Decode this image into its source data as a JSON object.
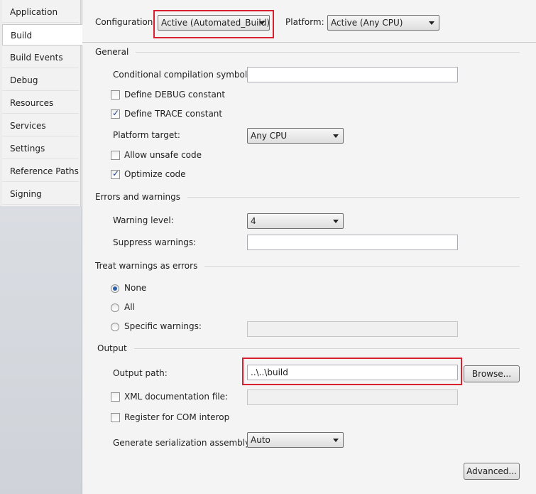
{
  "sidebar": {
    "items": [
      {
        "label": "Application"
      },
      {
        "label": "Build",
        "active": true
      },
      {
        "label": "Build Events"
      },
      {
        "label": "Debug"
      },
      {
        "label": "Resources"
      },
      {
        "label": "Services"
      },
      {
        "label": "Settings"
      },
      {
        "label": "Reference Paths"
      },
      {
        "label": "Signing"
      }
    ]
  },
  "header": {
    "configuration_label": "Configuration:",
    "configuration_value": "Active (Automated_Build)",
    "platform_label": "Platform:",
    "platform_value": "Active (Any CPU)"
  },
  "general": {
    "title": "General",
    "conditional_symbols_label": "Conditional compilation symbols:",
    "conditional_symbols_value": "",
    "define_debug_label": "Define DEBUG constant",
    "define_debug_checked": false,
    "define_trace_label": "Define TRACE constant",
    "define_trace_checked": true,
    "platform_target_label": "Platform target:",
    "platform_target_value": "Any CPU",
    "allow_unsafe_label": "Allow unsafe code",
    "allow_unsafe_checked": false,
    "optimize_label": "Optimize code",
    "optimize_checked": true
  },
  "errors": {
    "title": "Errors and warnings",
    "warning_level_label": "Warning level:",
    "warning_level_value": "4",
    "suppress_label": "Suppress warnings:",
    "suppress_value": ""
  },
  "treat_warnings": {
    "title": "Treat warnings as errors",
    "none_label": "None",
    "all_label": "All",
    "specific_label": "Specific warnings:",
    "selected": "none",
    "specific_value": ""
  },
  "output": {
    "title": "Output",
    "output_path_label": "Output path:",
    "output_path_value": "..\\..\\build",
    "browse_label": "Browse...",
    "xml_doc_label": "XML documentation file:",
    "xml_doc_checked": false,
    "xml_doc_value": "",
    "com_interop_label": "Register for COM interop",
    "com_interop_checked": false,
    "serialization_label": "Generate serialization assembly:",
    "serialization_value": "Auto",
    "advanced_label": "Advanced..."
  },
  "colors": {
    "highlight": "#d9202e",
    "check_mark": "#23407a",
    "radio_dot": "#2a5ea8"
  }
}
